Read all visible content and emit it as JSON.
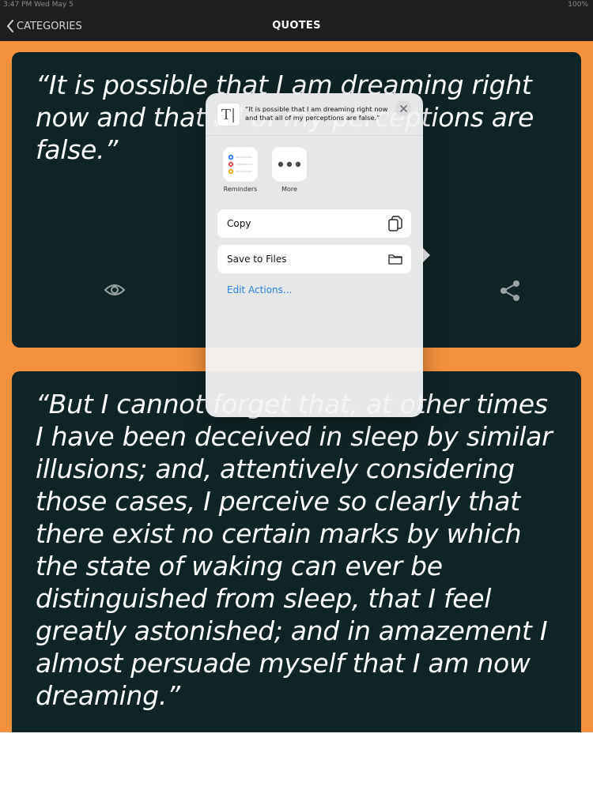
{
  "status_bar": {
    "left": "3:47 PM   Wed May 5",
    "right": "100%"
  },
  "nav": {
    "back_label": "CATEGORIES",
    "title": "QUOTES"
  },
  "cards": [
    {
      "quote": "“It is possible that I am dreaming right now and that all of my perceptions are false.”"
    },
    {
      "quote": "“But I cannot forget that, at other times I have been deceived in sleep by similar illusions; and, attentively considering those cases, I perceive so clearly that there exist no certain marks by which the state of waking can ever be distinguished from sleep, that I feel greatly astonished; and in amazement I almost persuade myself that I am now dreaming.”"
    }
  ],
  "share_sheet": {
    "preview_text": "“It is possible that I am dreaming right now and that all of my perceptions are false.”",
    "apps": [
      {
        "label": "Reminders",
        "icon": "reminders-icon"
      },
      {
        "label": "More",
        "icon": "more-icon"
      }
    ],
    "actions": [
      {
        "label": "Copy",
        "icon": "copy-icon"
      },
      {
        "label": "Save to Files",
        "icon": "folder-icon"
      }
    ],
    "edit_actions_label": "Edit Actions..."
  },
  "colors": {
    "background_orange": "#f4913e",
    "card_background": "#0f2426",
    "navbar": "#1e1e1e",
    "link_blue": "#2b83e0"
  }
}
